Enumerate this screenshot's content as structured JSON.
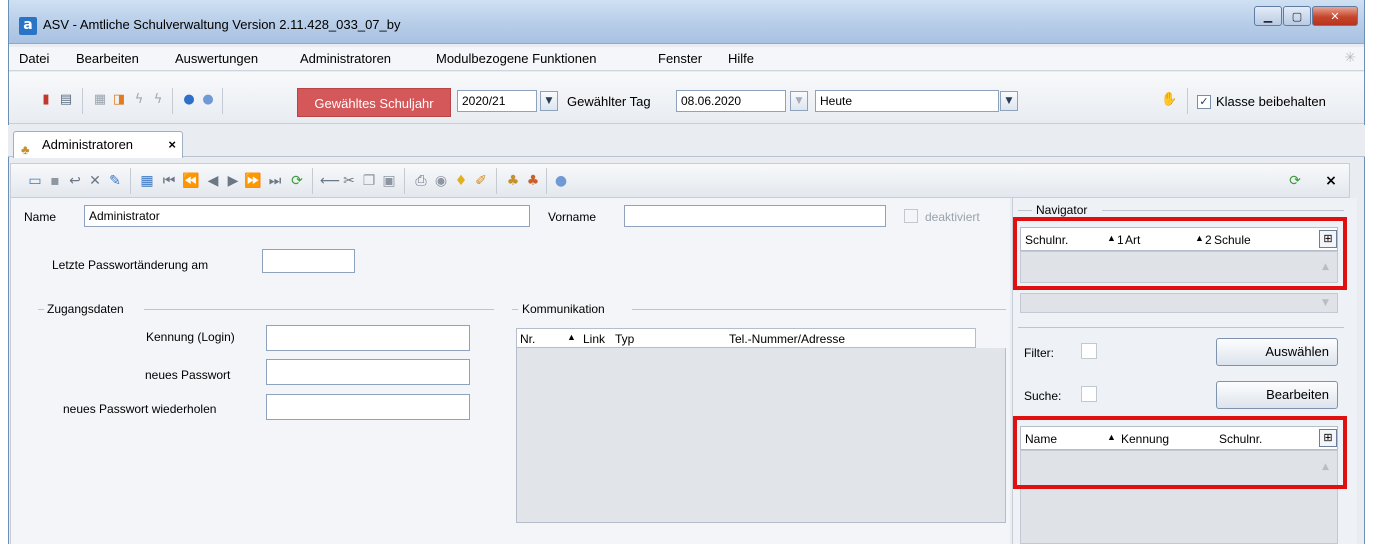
{
  "window": {
    "title": "ASV - Amtliche Schulverwaltung Version 2.11.428_033_07_by",
    "app_icon": "a"
  },
  "menu": [
    "Datei",
    "Bearbeiten",
    "Auswertungen",
    "Administratoren",
    "Modulbezogene Funktionen",
    "Fenster",
    "Hilfe"
  ],
  "toolbar": {
    "schuljahr_label": "Gewähltes Schuljahr",
    "schuljahr_value": "2020/21",
    "tag_label": "Gewählter Tag",
    "tag_value": "08.06.2020",
    "heute_value": "Heute",
    "klasse_label": "Klasse beibehalten",
    "klasse_checked": "✓"
  },
  "tab": {
    "label": "Administratoren",
    "close": "×"
  },
  "form": {
    "name_label": "Name",
    "name_value": "Administrator",
    "vorname_label": "Vorname",
    "vorname_value": "",
    "deaktiviert_label": "deaktiviert",
    "letzte_label": "Letzte Passwortänderung am",
    "zugang_title": "Zugangsdaten",
    "kennung_label": "Kennung (Login)",
    "pw_label": "neues Passwort",
    "pw2_label": "neues Passwort wiederholen",
    "komm_title": "Kommunikation",
    "komm_cols": {
      "nr": "Nr.",
      "link": "Link",
      "typ": "Typ",
      "tel": "Tel.-Nummer/Adresse"
    }
  },
  "navigator": {
    "title": "Navigator",
    "grid1_cols": {
      "schulnr": "Schulnr.",
      "sort1": "1",
      "art": "Art",
      "sort2": "2",
      "schule": "Schule"
    },
    "filter_label": "Filter:",
    "suche_label": "Suche:",
    "auswaehlen": "Auswählen",
    "bearbeiten": "Bearbeiten",
    "grid2_cols": {
      "name": "Name",
      "kennung": "Kennung",
      "schulnr": "Schulnr."
    }
  }
}
